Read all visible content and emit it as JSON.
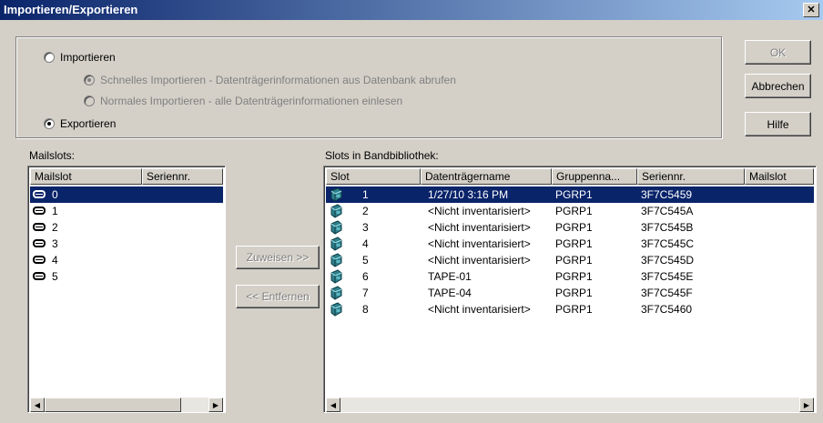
{
  "dialog": {
    "title": "Importieren/Exportieren",
    "close": "✕"
  },
  "mode": {
    "import_label": "Importieren",
    "fast_import_label": "Schnelles Importieren - Datenträgerinformationen aus Datenbank abrufen",
    "normal_import_label": "Normales Importieren - alle Datenträgerinformationen einlesen",
    "export_label": "Exportieren",
    "selected": "Exportieren"
  },
  "buttons": {
    "ok": "OK",
    "cancel": "Abbrechen",
    "help": "Hilfe",
    "assign": "Zuweisen >>",
    "remove": "<< Entfernen"
  },
  "mailslots": {
    "label": "Mailslots:",
    "columns": [
      "Mailslot",
      "Seriennr."
    ],
    "rows": [
      {
        "slot": "0",
        "serial": ""
      },
      {
        "slot": "1",
        "serial": ""
      },
      {
        "slot": "2",
        "serial": ""
      },
      {
        "slot": "3",
        "serial": ""
      },
      {
        "slot": "4",
        "serial": ""
      },
      {
        "slot": "5",
        "serial": ""
      }
    ],
    "selected_index": 0
  },
  "library": {
    "label": "Slots in Bandbibliothek:",
    "columns": [
      "Slot",
      "Datenträgername",
      "Gruppenna...",
      "Seriennr.",
      "Mailslot"
    ],
    "rows": [
      {
        "slot": "1",
        "name": "1/27/10 3:16 PM",
        "group": "PGRP1",
        "serial": "3F7C5459",
        "mailslot": ""
      },
      {
        "slot": "2",
        "name": "<Nicht inventarisiert>",
        "group": "PGRP1",
        "serial": "3F7C545A",
        "mailslot": ""
      },
      {
        "slot": "3",
        "name": "<Nicht inventarisiert>",
        "group": "PGRP1",
        "serial": "3F7C545B",
        "mailslot": ""
      },
      {
        "slot": "4",
        "name": "<Nicht inventarisiert>",
        "group": "PGRP1",
        "serial": "3F7C545C",
        "mailslot": ""
      },
      {
        "slot": "5",
        "name": "<Nicht inventarisiert>",
        "group": "PGRP1",
        "serial": "3F7C545D",
        "mailslot": ""
      },
      {
        "slot": "6",
        "name": "TAPE-01",
        "group": "PGRP1",
        "serial": "3F7C545E",
        "mailslot": ""
      },
      {
        "slot": "7",
        "name": "TAPE-04",
        "group": "PGRP1",
        "serial": "3F7C545F",
        "mailslot": ""
      },
      {
        "slot": "8",
        "name": "<Nicht inventarisiert>",
        "group": "PGRP1",
        "serial": "3F7C5460",
        "mailslot": ""
      }
    ],
    "selected_index": 0
  },
  "icons": {
    "mailslot": "mailslot-icon",
    "tape": "tape-cartridge-icon",
    "scroll_left": "◀",
    "scroll_right": "▶"
  }
}
